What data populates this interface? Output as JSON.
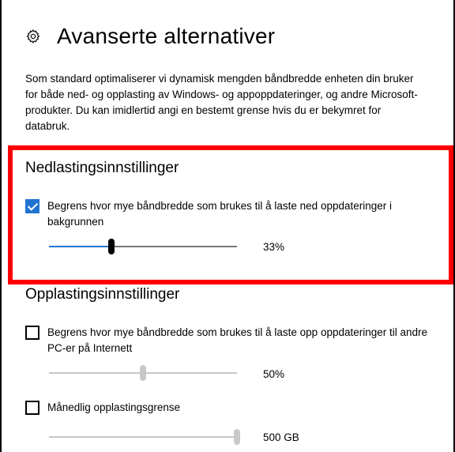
{
  "header": {
    "title": "Avanserte alternativer",
    "icon": "gear-icon"
  },
  "description": "Som standard optimaliserer vi dynamisk mengden båndbredde enheten din bruker for både ned- og opplasting av Windows- og appoppdateringer, og andre Microsoft-produkter. Du kan imidlertid angi en bestemt grense hvis du er bekymret for databruk.",
  "download": {
    "title": "Nedlastingsinnstillinger",
    "limit_label": "Begrens hvor mye båndbredde som brukes til å laste ned oppdateringer i bakgrunnen",
    "limit_checked": true,
    "slider_fraction": 0.33,
    "slider_value": "33%"
  },
  "upload": {
    "title": "Opplastingsinnstillinger",
    "limit_label": "Begrens hvor mye båndbredde som brukes til å laste opp oppdateringer til andre PC-er på Internett",
    "limit_checked": false,
    "slider_fraction": 0.5,
    "slider_value": "50%",
    "monthly_label": "Månedlig opplastingsgrense",
    "monthly_checked": false,
    "monthly_fraction": 1.0,
    "monthly_value": "500 GB"
  },
  "colors": {
    "accent": "#1f74d1",
    "highlight": "#ff0000"
  }
}
